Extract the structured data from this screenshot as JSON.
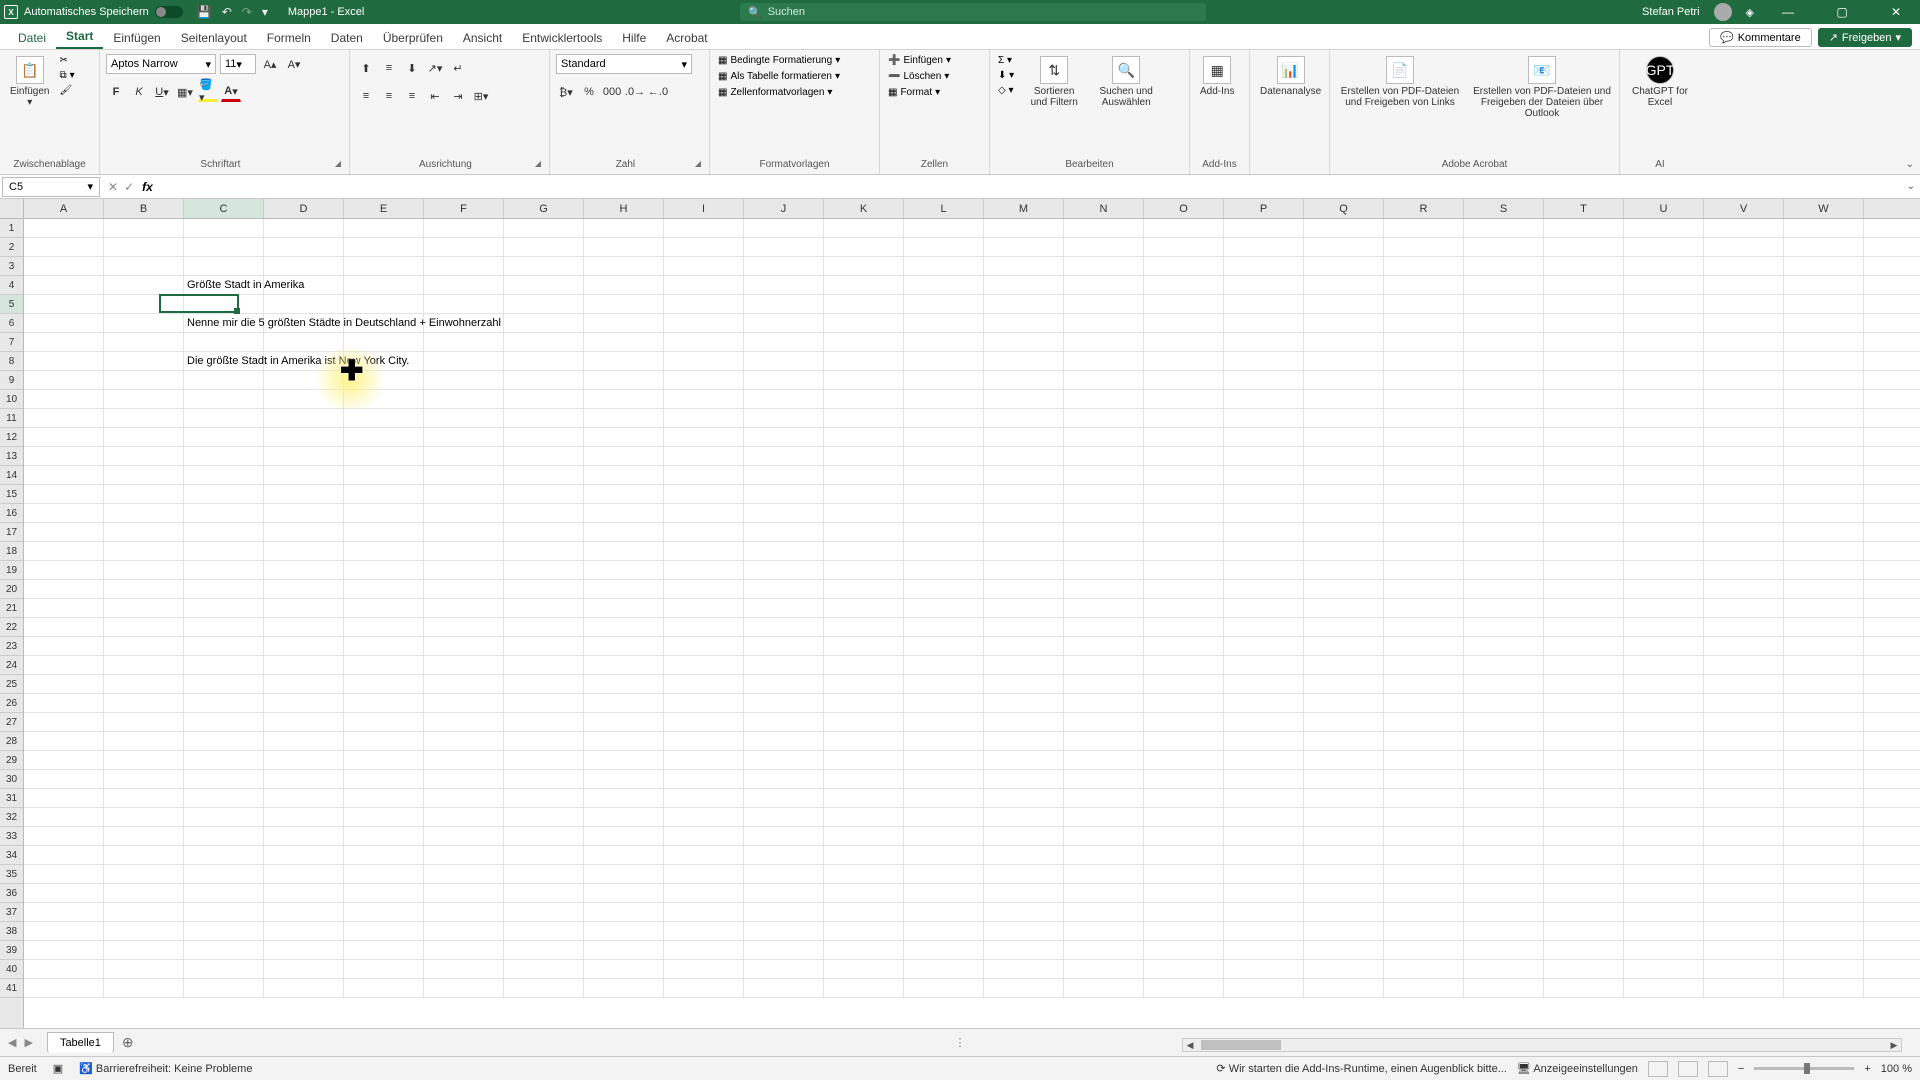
{
  "title_bar": {
    "autosave_label": "Automatisches Speichern",
    "doc_name": "Mappe1 - Excel",
    "search_placeholder": "Suchen",
    "user_name": "Stefan Petri"
  },
  "tabs": {
    "file": "Datei",
    "items": [
      "Start",
      "Einfügen",
      "Seitenlayout",
      "Formeln",
      "Daten",
      "Überprüfen",
      "Ansicht",
      "Entwicklertools",
      "Hilfe",
      "Acrobat"
    ],
    "active": "Start",
    "comments": "Kommentare",
    "share": "Freigeben"
  },
  "ribbon": {
    "clipboard": {
      "paste": "Einfügen",
      "label": "Zwischenablage"
    },
    "font": {
      "name": "Aptos Narrow",
      "size": "11",
      "label": "Schriftart"
    },
    "alignment": {
      "label": "Ausrichtung"
    },
    "number": {
      "format": "Standard",
      "label": "Zahl"
    },
    "styles": {
      "cond": "Bedingte Formatierung",
      "table": "Als Tabelle formatieren",
      "cell": "Zellenformatvorlagen",
      "label": "Formatvorlagen"
    },
    "cells": {
      "insert": "Einfügen",
      "delete": "Löschen",
      "format": "Format",
      "label": "Zellen"
    },
    "editing": {
      "sort": "Sortieren und Filtern",
      "find": "Suchen und Auswählen",
      "label": "Bearbeiten"
    },
    "addins": {
      "btn": "Add-Ins",
      "label": "Add-Ins"
    },
    "analysis": {
      "btn": "Datenanalyse"
    },
    "acrobat": {
      "pdf1": "Erstellen von PDF-Dateien und Freigeben von Links",
      "pdf2": "Erstellen von PDF-Dateien und Freigeben der Dateien über Outlook",
      "label": "Adobe Acrobat"
    },
    "ai": {
      "btn": "ChatGPT for Excel",
      "label": "AI"
    }
  },
  "formula": {
    "name_box": "C5",
    "value": ""
  },
  "columns": [
    "A",
    "B",
    "C",
    "D",
    "E",
    "F",
    "G",
    "H",
    "I",
    "J",
    "K",
    "L",
    "M",
    "N",
    "O",
    "P",
    "Q",
    "R",
    "S",
    "T",
    "U",
    "V",
    "W"
  ],
  "rows_count": 41,
  "active": {
    "col": 2,
    "row": 4
  },
  "cell_data": {
    "r3c2": "Größte Stadt in Amerika",
    "r5c2": "Nenne mir die 5 größten Städte in Deutschland + Einwohnerzahl",
    "r7c2": "Die größte Stadt in Amerika ist New York City."
  },
  "sheet": {
    "name": "Tabelle1"
  },
  "status": {
    "ready": "Bereit",
    "accessibility": "Barrierefreiheit: Keine Probleme",
    "addins_msg": "Wir starten die Add-Ins-Runtime, einen Augenblick bitte...",
    "display": "Anzeigeeinstellungen",
    "zoom": "100 %"
  }
}
